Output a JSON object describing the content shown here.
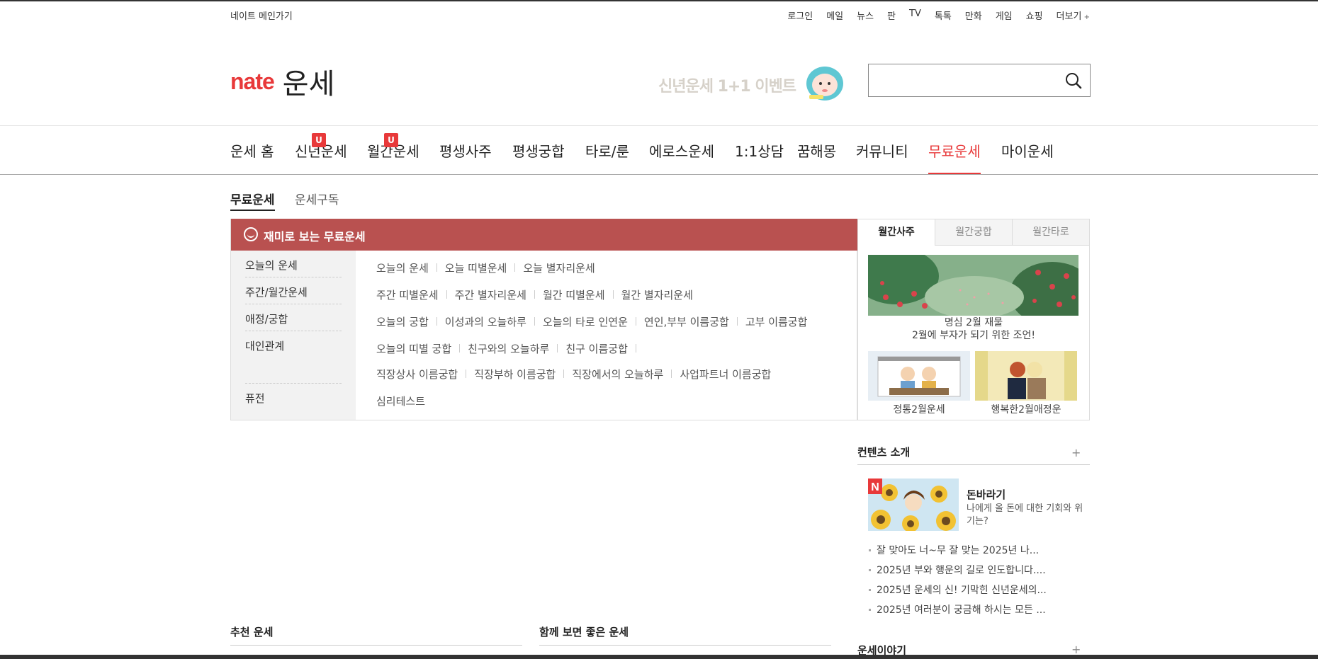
{
  "topbar": {
    "home_link": "네이트 메인가기",
    "links": [
      "로그인",
      "메일",
      "뉴스",
      "판",
      "TV",
      "톡톡",
      "만화",
      "게임",
      "쇼핑"
    ],
    "more": "더보기"
  },
  "header": {
    "logo_brand": "nate",
    "logo_title": "운세",
    "promo_text": "신년운세 1+1 이벤트",
    "search_placeholder": ""
  },
  "nav": {
    "items": [
      {
        "label": "운세 홈"
      },
      {
        "label": "신년운세",
        "badge": "U"
      },
      {
        "label": "월간운세",
        "badge": "U"
      },
      {
        "label": "평생사주"
      },
      {
        "label": "평생궁합"
      },
      {
        "label": "타로/룬"
      },
      {
        "label": "에로스운세"
      },
      {
        "label": "1:1상담"
      },
      {
        "label": "꿈해몽"
      },
      {
        "label": "커뮤니티"
      },
      {
        "label": "무료운세",
        "active": true
      },
      {
        "label": "마이운세"
      }
    ]
  },
  "subtabs": [
    "무료운세",
    "운세구독"
  ],
  "panel": {
    "title": "재미로 보는 무료운세",
    "categories": [
      "오늘의 운세",
      "주간/월간운세",
      "애정/궁합",
      "대인관계",
      "퓨전"
    ],
    "rows": [
      [
        "오늘의 운세",
        "오늘 띠별운세",
        "오늘 별자리운세"
      ],
      [
        "주간 띠별운세",
        "주간 별자리운세",
        "월간 띠별운세",
        "월간 별자리운세"
      ],
      [
        "오늘의 궁합",
        "이성과의 오늘하루",
        "오늘의 타로 인연운",
        "연인,부부 이름궁합",
        "고부 이름궁합"
      ],
      [
        "오늘의 띠별 궁합",
        "친구와의 오늘하루",
        "친구 이름궁합",
        ""
      ],
      [
        "직장상사 이름궁합",
        "직장부하 이름궁합",
        "직장에서의 오늘하루",
        "사업파트너 이름궁합"
      ],
      [
        "심리테스트"
      ]
    ]
  },
  "widget": {
    "tabs": [
      "월간사주",
      "월간궁합",
      "월간타로"
    ],
    "main_caption_1": "명심 2월 재물",
    "main_caption_2": "2월에 부자가 되기 위한 조언!",
    "thumb_captions": [
      "정통2월운세",
      "행복한2월애정운"
    ]
  },
  "content_intro": {
    "title": "컨텐츠 소개",
    "feature_badge": "N",
    "feature_title": "돈바라기",
    "feature_desc": "나에게 올 돈에 대한 기회와 위기는?",
    "bullets": [
      "잘 맞아도 너~무 잘 맞는 2025년 나...",
      "2025년 부와 행운의 길로 인도합니다....",
      "2025년 운세의 신! 기막힌 신년운세의...",
      "2025년 여러분이 궁금해 하시는 모든 ..."
    ]
  },
  "bottom_sections": {
    "recommended": "추천 운세",
    "together": "함께 보면 좋은 운세",
    "story": "운세이야기"
  },
  "colors": {
    "accent": "#e8393a",
    "panel_header": "#b95150"
  }
}
